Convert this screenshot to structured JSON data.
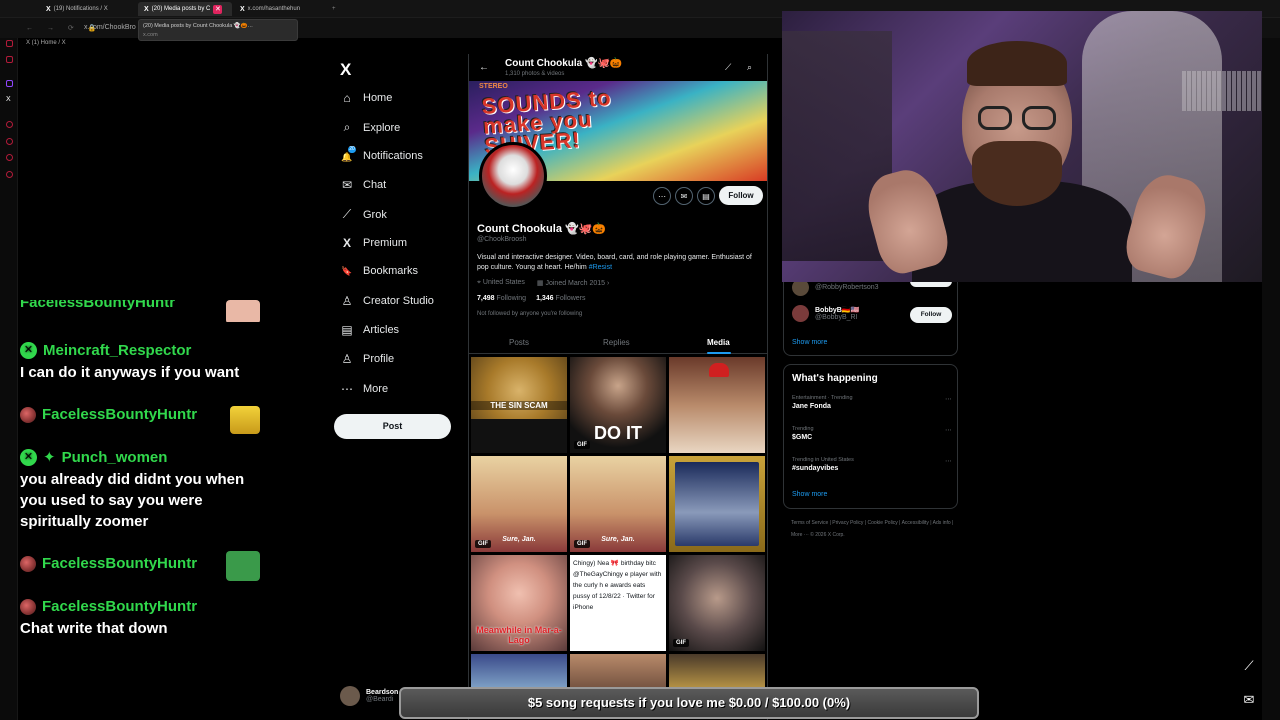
{
  "browser": {
    "tabs": [
      {
        "label": "(19) Notifications / X"
      },
      {
        "label": "(20) Media posts by C"
      },
      {
        "label": "x.com/hasanthehun"
      }
    ],
    "address": "x.com/ChookBro",
    "tooltip_title": "(20) Media posts by Count Chookula 👻🎃…",
    "tooltip_host": "x.com",
    "bookmark": "(1) Home / X"
  },
  "chat": {
    "messages": [
      {
        "user": "FacelessBountyHuntr",
        "text": ""
      },
      {
        "user": "Meincraft_Respector",
        "text": "I can do it anyways if you want"
      },
      {
        "user": "FacelessBountyHuntr",
        "text": ""
      },
      {
        "user": "Punch_women",
        "text": "you already did didnt you when you used to say you were spiritually zoomer"
      },
      {
        "user": "FacelessBountyHuntr",
        "text": ""
      },
      {
        "user": "FacelessBountyHuntr",
        "text": "Chat write that down"
      }
    ]
  },
  "nav": {
    "logo": "X",
    "items": [
      {
        "label": "Home",
        "icon": "⌂"
      },
      {
        "label": "Explore",
        "icon": "⌕"
      },
      {
        "label": "Notifications",
        "icon": "🔔"
      },
      {
        "label": "Chat",
        "icon": "✉"
      },
      {
        "label": "Grok",
        "icon": "⟋"
      },
      {
        "label": "Premium",
        "icon": "X"
      },
      {
        "label": "Bookmarks",
        "icon": "🔖"
      },
      {
        "label": "Creator Studio",
        "icon": "♙"
      },
      {
        "label": "Articles",
        "icon": "▤"
      },
      {
        "label": "Profile",
        "icon": "♙"
      },
      {
        "label": "More",
        "icon": "⋯"
      }
    ],
    "notif_count": "20",
    "post_label": "Post",
    "account_name": "Beardson",
    "account_handle": "@Beardi"
  },
  "profile": {
    "header_name": "Count Chookula 👻🐙🎃",
    "header_sub": "1,310 photos & videos",
    "banner_text": "SOUNDS to make you SHIVER!",
    "banner_sub": "STEREO",
    "name": "Count Chookula 👻🐙🎃",
    "handle": "@ChookBroosh",
    "bio": "Visual and interactive designer. Video, board, card, and role playing gamer. Enthusiast of pop culture. Young at heart. He/him",
    "bio_tag": "#Resist",
    "location": "United States",
    "joined": "Joined March 2015",
    "following_count": "7,498",
    "following_label": "Following",
    "followers_count": "1,346",
    "followers_label": "Followers",
    "not_followed": "Not followed by anyone you're following",
    "follow_label": "Follow",
    "tabs": [
      "Posts",
      "Replies",
      "Media"
    ],
    "media": [
      {
        "caption": "THE SIN SCAM",
        "gif": false
      },
      {
        "caption": "DO IT",
        "gif": true
      },
      {
        "caption": "",
        "gif": false
      },
      {
        "caption": "Sure, Jan.",
        "gif": true
      },
      {
        "caption": "Sure, Jan.",
        "gif": true
      },
      {
        "caption": "",
        "gif": false
      },
      {
        "caption": "Meanwhile in Mar-a-Lago",
        "gif": false
      },
      {
        "caption": "Chingy) Nea 🎀 birthday bitc @TheGayChingy e player with the curly h e awards eats pussy of 12/8/22 · Twitter for iPhone",
        "gif": false
      },
      {
        "caption": "",
        "gif": true
      }
    ],
    "gif_label": "GIF"
  },
  "sidebar": {
    "who_to_follow": [
      {
        "name": "",
        "handle": "@RobbyRobertson3",
        "follow": "Follow"
      },
      {
        "name": "BobbyB🇩🇪🇺🇸",
        "handle": "@BobbyB_RI",
        "follow": "Follow"
      }
    ],
    "show_more": "Show more",
    "whats_happening": "What's happening",
    "trends": [
      {
        "category": "Entertainment · Trending",
        "term": "Jane Fonda"
      },
      {
        "category": "Trending",
        "term": "$GMC"
      },
      {
        "category": "Trending in United States",
        "term": "#sundayvibes"
      }
    ],
    "footer": "Terms of Service | Privacy Policy | Cookie Policy | Accessibility | Ads info | More ··· © 2026 X Corp."
  },
  "donation": "$5 song requests if you love me $0.00 / $100.00 (0%)",
  "colors": {
    "accent": "#1d9bf0",
    "chat_user": "#31d84c",
    "background": "#000000"
  }
}
